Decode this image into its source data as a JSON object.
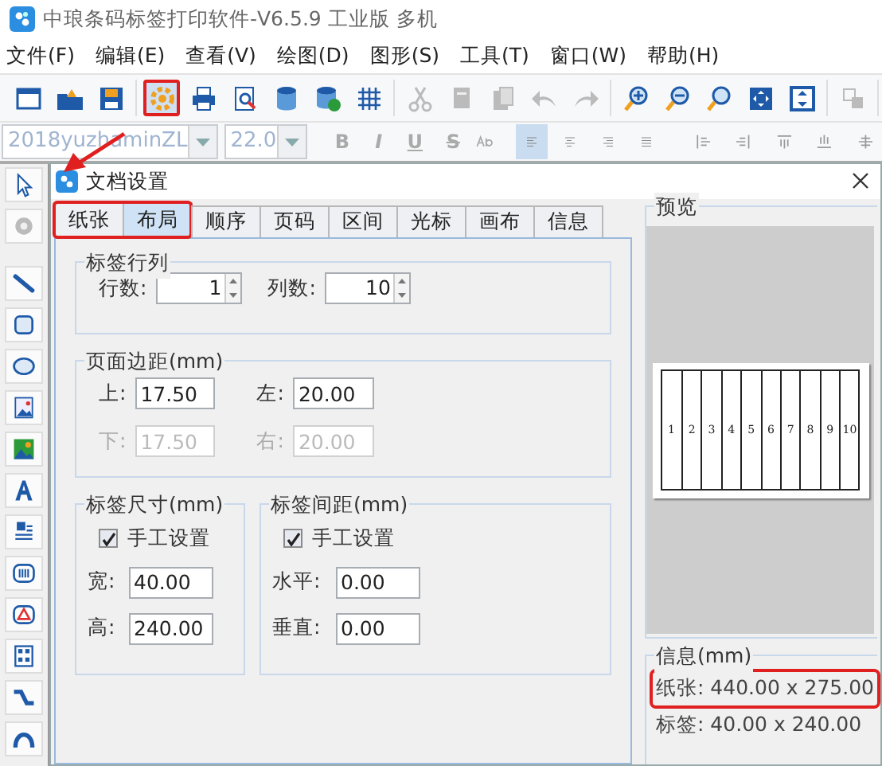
{
  "app_title": "中琅条码标签打印软件-V6.5.9 工业版 多机",
  "menu": [
    "文件(F)",
    "编辑(E)",
    "查看(V)",
    "绘图(D)",
    "图形(S)",
    "工具(T)",
    "窗口(W)",
    "帮助(H)"
  ],
  "toolbar": [
    [
      {
        "kind": "window",
        "disabled": false,
        "highlighted": false
      },
      {
        "kind": "open",
        "disabled": false,
        "highlighted": false
      },
      {
        "kind": "save",
        "disabled": false,
        "highlighted": false
      }
    ],
    [
      {
        "kind": "settings",
        "disabled": false,
        "highlighted": true
      },
      {
        "kind": "print",
        "disabled": false,
        "highlighted": false
      },
      {
        "kind": "preview",
        "disabled": false,
        "highlighted": false
      },
      {
        "kind": "database",
        "disabled": false,
        "highlighted": false
      },
      {
        "kind": "database-check",
        "disabled": false,
        "highlighted": false
      },
      {
        "kind": "grid",
        "disabled": false,
        "highlighted": false
      }
    ],
    [
      {
        "kind": "cut",
        "disabled": true,
        "highlighted": false
      },
      {
        "kind": "copy",
        "disabled": true,
        "highlighted": false
      },
      {
        "kind": "paste",
        "disabled": true,
        "highlighted": false
      },
      {
        "kind": "undo",
        "disabled": true,
        "highlighted": false
      },
      {
        "kind": "redo",
        "disabled": true,
        "highlighted": false
      }
    ],
    [
      {
        "kind": "zoom-in",
        "disabled": false,
        "highlighted": false
      },
      {
        "kind": "zoom-out",
        "disabled": false,
        "highlighted": false
      },
      {
        "kind": "zoom",
        "disabled": false,
        "highlighted": false
      },
      {
        "kind": "fit",
        "disabled": false,
        "highlighted": false
      },
      {
        "kind": "fit-page",
        "disabled": false,
        "highlighted": false
      }
    ],
    [
      {
        "kind": "layers",
        "disabled": true,
        "highlighted": false
      }
    ]
  ],
  "format_bar": {
    "font": "2018yuzhaminZL",
    "size": "22.0",
    "text_styles": [
      {
        "label": "B",
        "disabled": true
      },
      {
        "label": "I",
        "disabled": true
      },
      {
        "label": "U",
        "disabled": true
      },
      {
        "label": "S",
        "disabled": true
      }
    ],
    "align": [
      {
        "kind": "left",
        "selected": true
      },
      {
        "kind": "center",
        "selected": false
      },
      {
        "kind": "right",
        "selected": false
      },
      {
        "kind": "justify",
        "selected": false
      }
    ],
    "distribute": [
      {
        "kind": "h-left"
      },
      {
        "kind": "h-right"
      },
      {
        "kind": "v-top"
      },
      {
        "kind": "v-bottom"
      },
      {
        "kind": "center"
      }
    ]
  },
  "left_tools": [
    {
      "kind": "pointer",
      "disabled": false
    },
    {
      "kind": "rotate",
      "disabled": true
    },
    {
      "kind": "line",
      "disabled": false
    },
    {
      "kind": "rect",
      "disabled": false
    },
    {
      "kind": "ellipse",
      "disabled": false
    },
    {
      "kind": "image",
      "disabled": false
    },
    {
      "kind": "picture",
      "disabled": false
    },
    {
      "kind": "text",
      "disabled": false
    },
    {
      "kind": "richtext",
      "disabled": false
    },
    {
      "kind": "barcode",
      "disabled": false
    },
    {
      "kind": "triangle",
      "disabled": false
    },
    {
      "kind": "qrcode",
      "disabled": false
    },
    {
      "kind": "curve",
      "disabled": false
    },
    {
      "kind": "arc",
      "disabled": false
    }
  ],
  "dialog": {
    "title": "文档设置",
    "tabs": [
      {
        "label": "纸张",
        "selected": false,
        "highlighted": true
      },
      {
        "label": "布局",
        "selected": true,
        "highlighted": true
      },
      {
        "label": "顺序",
        "selected": false,
        "highlighted": false
      },
      {
        "label": "页码",
        "selected": false,
        "highlighted": false
      },
      {
        "label": "区间",
        "selected": false,
        "highlighted": false
      },
      {
        "label": "光标",
        "selected": false,
        "highlighted": false
      },
      {
        "label": "画布",
        "selected": false,
        "highlighted": false
      },
      {
        "label": "信息",
        "selected": false,
        "highlighted": false
      }
    ],
    "rows_cols": {
      "title": "标签行列",
      "fields": [
        {
          "label": "行数:",
          "value": "1"
        },
        {
          "label": "列数:",
          "value": "10"
        }
      ]
    },
    "margins": {
      "title": "页面边距(mm)",
      "fields": [
        {
          "label": "上:",
          "value": "17.50",
          "disabled": false
        },
        {
          "label": "左:",
          "value": "20.00",
          "disabled": false
        },
        {
          "label": "下:",
          "value": "17.50",
          "disabled": true
        },
        {
          "label": "右:",
          "value": "20.00",
          "disabled": true
        }
      ]
    },
    "label_size": {
      "title": "标签尺寸(mm)",
      "manual": {
        "label": "手工设置",
        "checked": true
      },
      "fields": [
        {
          "label": "宽:",
          "value": "40.00"
        },
        {
          "label": "高:",
          "value": "240.00"
        }
      ]
    },
    "label_gap": {
      "title": "标签间距(mm)",
      "manual": {
        "label": "手工设置",
        "checked": true
      },
      "fields": [
        {
          "label": "水平:",
          "value": "0.00"
        },
        {
          "label": "垂直:",
          "value": "0.00"
        }
      ]
    },
    "preview": {
      "title": "预览",
      "labels": [
        "1",
        "2",
        "3",
        "4",
        "5",
        "6",
        "7",
        "8",
        "9",
        "10"
      ]
    },
    "info": {
      "title": "信息(mm)",
      "lines": [
        {
          "text": "纸张: 440.00 x 275.00",
          "highlighted": true
        },
        {
          "text": "标签: 40.00 x 240.00",
          "highlighted": false
        }
      ]
    }
  },
  "annotation_arrow": true
}
